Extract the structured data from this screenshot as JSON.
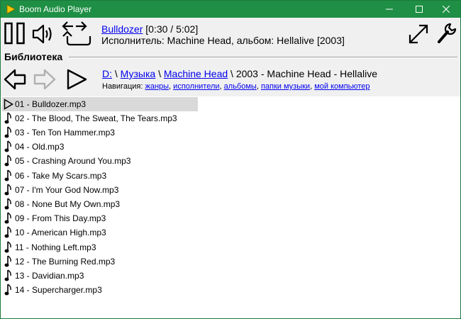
{
  "window": {
    "title": "Boom Audio Player"
  },
  "player": {
    "track_name": "Bulldozer",
    "time": "[0:30 / 5:02]",
    "info": "Исполнитель: Machine Head, альбом: Hellalive [2003]",
    "controls": [
      "pause-icon",
      "volume-icon",
      "repeat-icon",
      "fullscreen-icon",
      "settings-wrench-icon"
    ]
  },
  "library": {
    "label": "Библиотека",
    "path": {
      "drive": "D:",
      "sep": " \\ ",
      "folder1": "Музыка",
      "folder2": "Machine Head",
      "current": "2003 - Machine Head - Hellalive"
    },
    "navigation": {
      "label": "Навигация:",
      "links": [
        "жанры",
        "исполнители",
        "альбомы",
        "папки музыки",
        "мой компьютер"
      ]
    }
  },
  "tracks": [
    "01 - Bulldozer.mp3",
    "02 - The Blood, The Sweat, The Tears.mp3",
    "03 - Ten Ton Hammer.mp3",
    "04 - Old.mp3",
    "05 - Crashing Around You.mp3",
    "06 - Take My Scars.mp3",
    "07 - I'm Your God Now.mp3",
    "08 - None But My Own.mp3",
    "09 - From This Day.mp3",
    "10 - American High.mp3",
    "11 - Nothing Left.mp3",
    "12 - The Burning Red.mp3",
    "13 - Davidian.mp3",
    "14 - Supercharger.mp3"
  ],
  "colors": {
    "titlebar": "#1e8f44",
    "link": "#0000ee",
    "selected_row": "#d9d9d9"
  }
}
